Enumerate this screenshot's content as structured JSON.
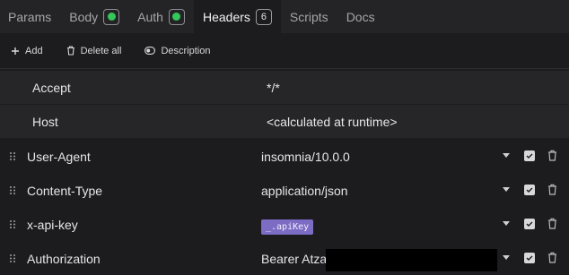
{
  "tabs": [
    {
      "label": "Params",
      "indicator": "none"
    },
    {
      "label": "Body",
      "indicator": "dot"
    },
    {
      "label": "Auth",
      "indicator": "dot"
    },
    {
      "label": "Headers",
      "indicator": "count",
      "count": "6",
      "active": true
    },
    {
      "label": "Scripts",
      "indicator": "none"
    },
    {
      "label": "Docs",
      "indicator": "none"
    }
  ],
  "toolbar": {
    "add_label": "Add",
    "delete_all_label": "Delete all",
    "description_label": "Description"
  },
  "static_headers": [
    {
      "name": "Accept",
      "value": "*/*"
    },
    {
      "name": "Host",
      "value": "<calculated at runtime>"
    }
  ],
  "headers": [
    {
      "name": "User-Agent",
      "value": "insomnia/10.0.0"
    },
    {
      "name": "Content-Type",
      "value": "application/json"
    },
    {
      "name": "x-api-key",
      "value_tag": "_.apiKey"
    },
    {
      "name": "Authorization",
      "value": "Bearer Atza"
    }
  ],
  "colors": {
    "success_dot": "#34c759",
    "template_tag": "#7c6cc4",
    "background": "#1c1c1e"
  },
  "icons": {
    "drag": "grip-icon",
    "dropdown": "chevron-down-icon",
    "enabled": "checkbox-checked-icon",
    "delete": "trash-icon"
  }
}
